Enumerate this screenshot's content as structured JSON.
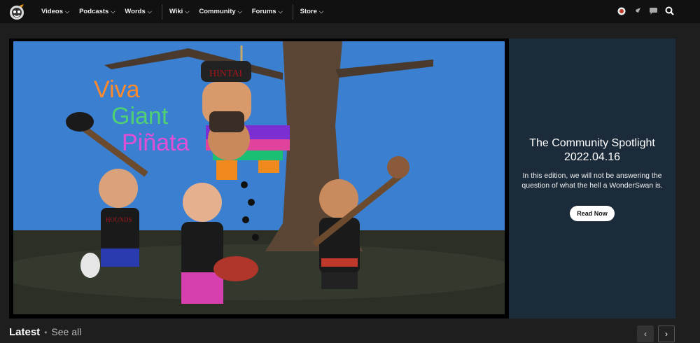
{
  "nav": {
    "items": [
      {
        "label": "Videos",
        "has_dropdown": true
      },
      {
        "label": "Podcasts",
        "has_dropdown": true
      },
      {
        "label": "Words",
        "has_dropdown": true
      },
      {
        "label": "Wiki",
        "has_dropdown": true
      },
      {
        "label": "Community",
        "has_dropdown": true
      },
      {
        "label": "Forums",
        "has_dropdown": true
      },
      {
        "label": "Store",
        "has_dropdown": true
      }
    ],
    "chevron": "⌵"
  },
  "header_icons": [
    "user-avatar-icon",
    "rocket-icon",
    "chat-icon",
    "search-icon"
  ],
  "hero": {
    "art_title": "Viva Giant Piñata",
    "art_word1": "Viva",
    "art_word2": "Giant",
    "art_word3": "Piñata",
    "hat_text": "HINTAI",
    "shirt_text": "HOUNDS"
  },
  "promo": {
    "title_line1": "The Community Spotlight",
    "title_line2": "2022.04.16",
    "body": "In this edition, we will not be answering the question of what the hell a WonderSwan is.",
    "button": "Read Now"
  },
  "latest": {
    "title": "Latest",
    "dot": "•",
    "see_all": "See all",
    "prev": "‹",
    "next": "›"
  },
  "colors": {
    "topbar": "#111111",
    "background": "#1e1e1e",
    "promo_bg": "#1b2b3a",
    "sky": "#3b7fd1"
  }
}
